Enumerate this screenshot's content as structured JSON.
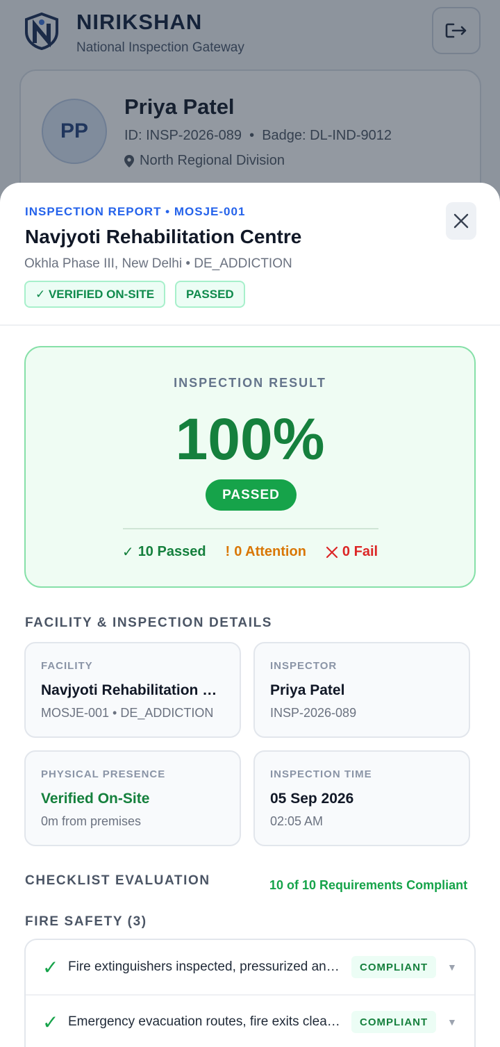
{
  "app": {
    "brand_title": "NIRIKSHAN",
    "brand_subtitle": "National Inspection Gateway",
    "logo_letter": "N"
  },
  "profile": {
    "initials": "PP",
    "name": "Priya Patel",
    "id_badge": "ID: INSP-2026-089  •  Badge: DL-IND-9012",
    "division": "North Regional Division"
  },
  "report": {
    "eyebrow": "INSPECTION REPORT • MOSJE-001",
    "facility_name": "Navjyoti Rehabilitation Centre",
    "location_line": "Okhla Phase III, New Delhi • DE_ADDICTION",
    "badges": [
      "✓ VERIFIED ON-SITE",
      "PASSED"
    ]
  },
  "result": {
    "label": "INSPECTION RESULT",
    "score": "100%",
    "status": "PASSED",
    "passed": "10 Passed",
    "attention": "0 Attention",
    "fail": "0 Fail"
  },
  "details": {
    "section_title": "FACILITY & INSPECTION DETAILS",
    "cards": [
      {
        "label": "FACILITY",
        "value": "Navjyoti Rehabilitation Centre",
        "sub": "MOSJE-001 • DE_ADDICTION"
      },
      {
        "label": "INSPECTOR",
        "value": "Priya Patel",
        "sub": "INSP-2026-089"
      },
      {
        "label": "PHYSICAL PRESENCE",
        "value": "Verified On-Site",
        "sub": "0m from premises"
      },
      {
        "label": "INSPECTION TIME",
        "value": "05 Sep 2026",
        "sub": "02:05 AM"
      }
    ]
  },
  "checklist": {
    "section_title": "CHECKLIST EVALUATION",
    "summary": "10 of 10 Requirements Compliant",
    "category": "FIRE SAFETY (3)",
    "items": [
      {
        "text": "Fire extinguishers inspected, pressurized and accessible",
        "status": "COMPLIANT"
      },
      {
        "text": "Emergency evacuation routes, fire exits clearly marked",
        "status": "COMPLIANT"
      }
    ]
  },
  "colors": {
    "accent_blue": "#2563eb",
    "pass_green": "#16a34a",
    "attention_amber": "#d97706",
    "fail_red": "#dc2626"
  }
}
